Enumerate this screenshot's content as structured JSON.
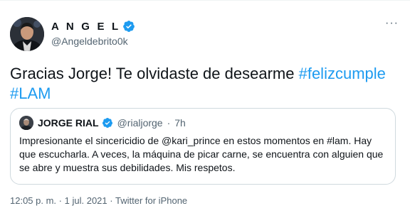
{
  "author": {
    "display_name": "A N G E L",
    "handle": "@Angeldebrito0k",
    "verified": true
  },
  "more_menu_label": "···",
  "tweet": {
    "text_prefix": "Gracias Jorge! Te olvidaste de desearme ",
    "hashtags": [
      "#felizcumple",
      "#LAM"
    ]
  },
  "quoted_tweet": {
    "display_name": "JORGE RIAL",
    "verified": true,
    "handle": "@rialjorge",
    "separator": "·",
    "time": "7h",
    "text": "Impresionante el sincericidio de @kari_prince  en estos momentos en #lam. Hay que escucharla. A veces, la máquina de picar carne, se encuentra con alguien que se abre y muestra sus debilidades. Mis respetos."
  },
  "footer": {
    "time": "12:05 p. m.",
    "separator": "·",
    "date": "1 jul. 2021",
    "source": "Twitter for iPhone"
  },
  "colors": {
    "accent": "#1d9bf0",
    "verified_badge": "#1d9bf0",
    "secondary_text": "#536471",
    "border": "#cfd9de"
  },
  "icons": {
    "verified": "verified-badge-icon",
    "more": "more-icon"
  }
}
